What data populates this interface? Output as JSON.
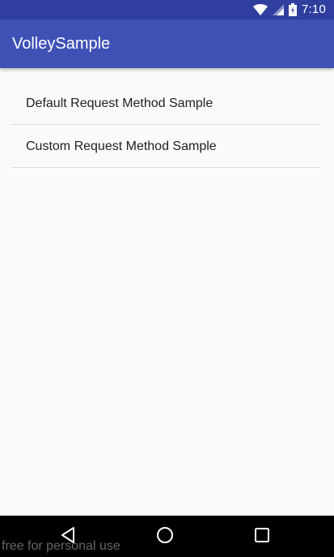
{
  "status_bar": {
    "time": "7:10",
    "icons": [
      "wifi-icon",
      "signal-icon",
      "battery-icon"
    ],
    "color": "#303f9f"
  },
  "app_bar": {
    "title": "VolleySample",
    "color": "#3f51b5"
  },
  "list": {
    "items": [
      {
        "label": "Default Request Method Sample"
      },
      {
        "label": "Custom Request Method Sample"
      }
    ]
  },
  "nav_bar": {
    "buttons": [
      "back-icon",
      "home-icon",
      "recents-icon"
    ]
  },
  "watermark": {
    "text": "free for personal use"
  }
}
